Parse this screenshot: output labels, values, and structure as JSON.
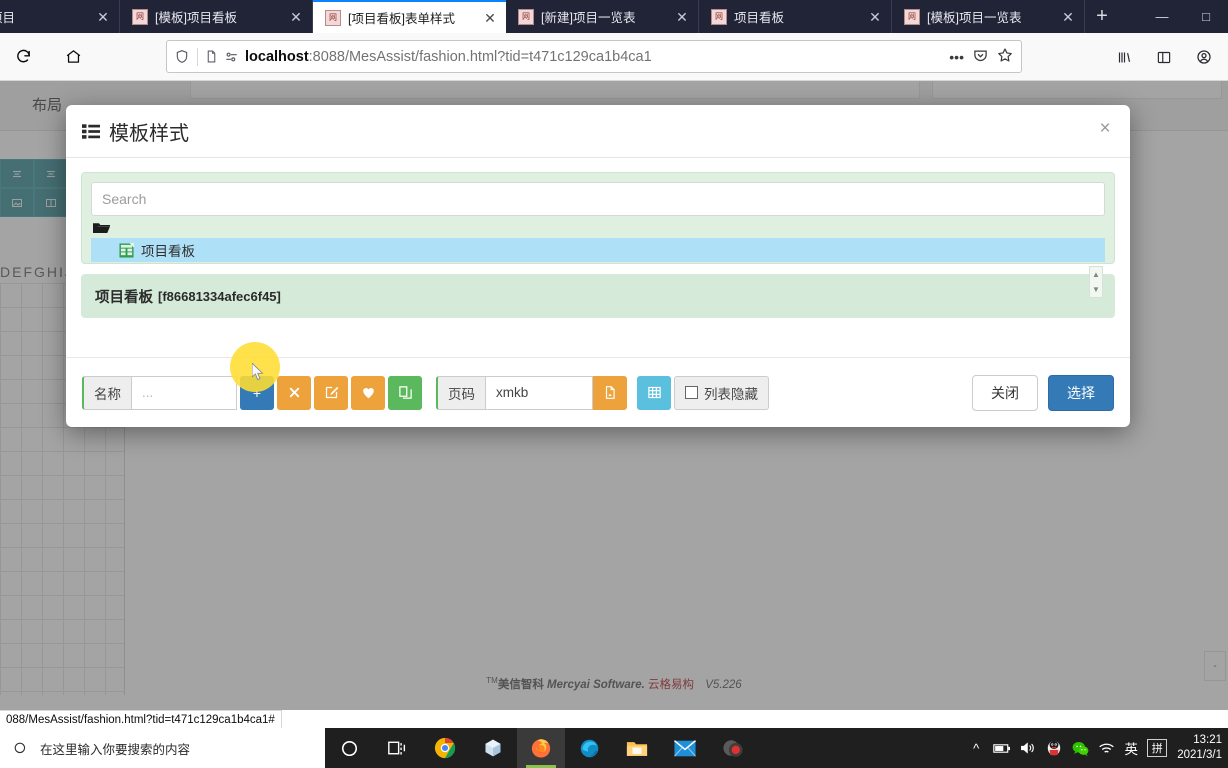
{
  "browser": {
    "tabs": [
      {
        "label": "项目",
        "favicon": "site-favicon",
        "active": false,
        "partial": true
      },
      {
        "label": "[模板]项目看板",
        "favicon": "site-favicon",
        "active": false
      },
      {
        "label": "[项目看板]表单样式",
        "favicon": "site-favicon",
        "active": true
      },
      {
        "label": "[新建]项目一览表",
        "favicon": "site-favicon",
        "active": false
      },
      {
        "label": "项目看板",
        "favicon": "site-favicon",
        "active": false
      },
      {
        "label": "[模板]项目一览表",
        "favicon": "site-favicon",
        "active": false
      }
    ],
    "new_tab_label": "+",
    "window_controls": {
      "minimize": "—",
      "maximize": "□"
    },
    "toolbar": {
      "reload_label": "⟳",
      "home_label": "⌂"
    },
    "url": {
      "host": "localhost",
      "path": ":8088/MesAssist/fashion.html?tid=t471c129ca1b4ca1",
      "full": "localhost:8088/MesAssist/fashion.html?tid=t471c129ca1b4ca1"
    }
  },
  "page": {
    "layout_label": "布局",
    "column_headers": "DEFGHIJ",
    "footer": {
      "tm": "TM",
      "brand_cn": "美信智科",
      "brand_en": "Mercyai Software.",
      "brand_red": "云格易构",
      "version": "V5.226"
    },
    "mini_box_label": "-"
  },
  "modal": {
    "title": "模板样式",
    "title_icon": "list-icon",
    "close_label": "×",
    "search": {
      "placeholder": "Search",
      "value": ""
    },
    "tree": {
      "folder_icon": "folder-open-icon",
      "items": [
        {
          "label": "项目看板",
          "icon": "sheet-icon",
          "selected": true
        }
      ],
      "scroll_up": "▲",
      "scroll_down": "▼"
    },
    "selected_info": {
      "name": "项目看板",
      "id": "[f86681334afec6f45]"
    },
    "toolbar": {
      "name_label": "名称",
      "name_placeholder": "...",
      "name_value": "",
      "add_button": "+",
      "delete_button": "✕",
      "edit_button": "edit-icon",
      "favorite_button": "heart-icon",
      "copy_button": "copy-icon",
      "page_label": "页码",
      "page_value": "xmkb",
      "export_button": "file-export-icon",
      "grid_button": "grid-icon",
      "hide_list_label": "列表隐藏",
      "hide_list_checked": false
    },
    "footer_buttons": {
      "close": "关闭",
      "select": "选择"
    }
  },
  "statusbar": {
    "text": "088/MesAssist/fashion.html?tid=t471c129ca1b4ca1#"
  },
  "taskbar": {
    "search_placeholder": "在这里输入你要搜索的内容",
    "search_icon": "search-circle-icon",
    "apps": [
      {
        "name": "cortana-icon"
      },
      {
        "name": "task-view-icon"
      },
      {
        "name": "chrome-icon"
      },
      {
        "name": "3d-viewer-icon"
      },
      {
        "name": "firefox-icon",
        "active": true
      },
      {
        "name": "edge-icon"
      },
      {
        "name": "file-explorer-icon"
      },
      {
        "name": "mail-icon"
      },
      {
        "name": "recorder-icon"
      }
    ],
    "tray": {
      "chevron": "^",
      "battery": "battery-icon",
      "volume": "volume-icon",
      "qq": "qq-icon",
      "wechat": "wechat-icon",
      "wifi": "wifi-icon",
      "ime_lang": "英",
      "ime_mode": "拼"
    },
    "clock": {
      "time": "13:21",
      "date": "2021/3/1"
    }
  },
  "colors": {
    "accent_blue": "#337ab7",
    "orange": "#eda23b",
    "green": "#5cb85c",
    "cyan": "#5bc0de",
    "tree_selected": "#aee0f7",
    "panel_green": "#d5ead8",
    "tab_bar": "#212337",
    "cursor_highlight": "#ffdd33"
  }
}
